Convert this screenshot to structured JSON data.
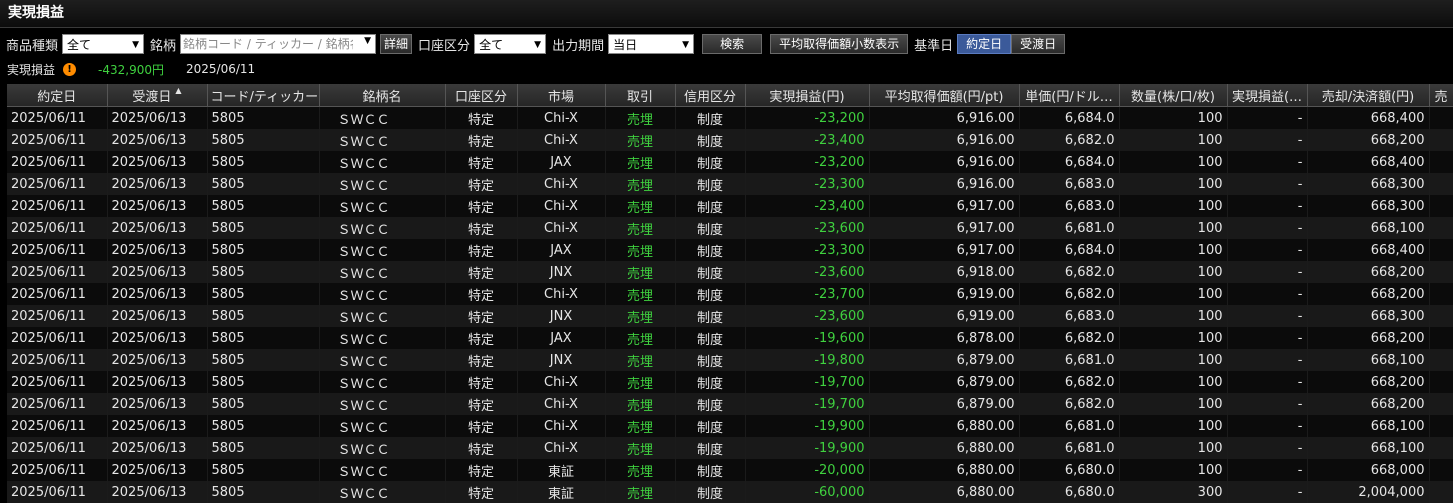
{
  "title": "実現損益",
  "filters": {
    "product_label": "商品種類",
    "product_value": "全て",
    "symbol_label": "銘柄",
    "symbol_placeholder": "銘柄コード / ティッカー / 銘柄名",
    "detail_label": "詳細",
    "account_label": "口座区分",
    "account_value": "全て",
    "period_label": "出力期間",
    "period_value": "当日",
    "search_label": "検索",
    "decimal_label": "平均取得価額小数表示",
    "basis_label": "基準日",
    "basis_contract": "約定日",
    "basis_delivery": "受渡日"
  },
  "summary": {
    "label": "実現損益",
    "value": "-432,900円",
    "date": "2025/06/11"
  },
  "columns": [
    "約定日",
    "受渡日",
    "コード/ティッカー",
    "銘柄名",
    "口座区分",
    "市場",
    "取引",
    "信用区分",
    "実現損益(円)",
    "平均取得価額(円/pt)",
    "単価(円/ドル…",
    "数量(株/口/枚)",
    "実現損益(…",
    "売却/決済額(円)",
    "売"
  ],
  "rows": [
    [
      "2025/06/11",
      "2025/06/13",
      "5805",
      "ＳＷＣＣ",
      "特定",
      "Chi-X",
      "売埋",
      "制度",
      "-23,200",
      "6,916.00",
      "6,684.0",
      "100",
      "-",
      "668,400"
    ],
    [
      "2025/06/11",
      "2025/06/13",
      "5805",
      "ＳＷＣＣ",
      "特定",
      "Chi-X",
      "売埋",
      "制度",
      "-23,400",
      "6,916.00",
      "6,682.0",
      "100",
      "-",
      "668,200"
    ],
    [
      "2025/06/11",
      "2025/06/13",
      "5805",
      "ＳＷＣＣ",
      "特定",
      "JAX",
      "売埋",
      "制度",
      "-23,200",
      "6,916.00",
      "6,684.0",
      "100",
      "-",
      "668,400"
    ],
    [
      "2025/06/11",
      "2025/06/13",
      "5805",
      "ＳＷＣＣ",
      "特定",
      "Chi-X",
      "売埋",
      "制度",
      "-23,300",
      "6,916.00",
      "6,683.0",
      "100",
      "-",
      "668,300"
    ],
    [
      "2025/06/11",
      "2025/06/13",
      "5805",
      "ＳＷＣＣ",
      "特定",
      "Chi-X",
      "売埋",
      "制度",
      "-23,400",
      "6,917.00",
      "6,683.0",
      "100",
      "-",
      "668,300"
    ],
    [
      "2025/06/11",
      "2025/06/13",
      "5805",
      "ＳＷＣＣ",
      "特定",
      "Chi-X",
      "売埋",
      "制度",
      "-23,600",
      "6,917.00",
      "6,681.0",
      "100",
      "-",
      "668,100"
    ],
    [
      "2025/06/11",
      "2025/06/13",
      "5805",
      "ＳＷＣＣ",
      "特定",
      "JAX",
      "売埋",
      "制度",
      "-23,300",
      "6,917.00",
      "6,684.0",
      "100",
      "-",
      "668,400"
    ],
    [
      "2025/06/11",
      "2025/06/13",
      "5805",
      "ＳＷＣＣ",
      "特定",
      "JNX",
      "売埋",
      "制度",
      "-23,600",
      "6,918.00",
      "6,682.0",
      "100",
      "-",
      "668,200"
    ],
    [
      "2025/06/11",
      "2025/06/13",
      "5805",
      "ＳＷＣＣ",
      "特定",
      "Chi-X",
      "売埋",
      "制度",
      "-23,700",
      "6,919.00",
      "6,682.0",
      "100",
      "-",
      "668,200"
    ],
    [
      "2025/06/11",
      "2025/06/13",
      "5805",
      "ＳＷＣＣ",
      "特定",
      "JNX",
      "売埋",
      "制度",
      "-23,600",
      "6,919.00",
      "6,683.0",
      "100",
      "-",
      "668,300"
    ],
    [
      "2025/06/11",
      "2025/06/13",
      "5805",
      "ＳＷＣＣ",
      "特定",
      "JAX",
      "売埋",
      "制度",
      "-19,600",
      "6,878.00",
      "6,682.0",
      "100",
      "-",
      "668,200"
    ],
    [
      "2025/06/11",
      "2025/06/13",
      "5805",
      "ＳＷＣＣ",
      "特定",
      "JNX",
      "売埋",
      "制度",
      "-19,800",
      "6,879.00",
      "6,681.0",
      "100",
      "-",
      "668,100"
    ],
    [
      "2025/06/11",
      "2025/06/13",
      "5805",
      "ＳＷＣＣ",
      "特定",
      "Chi-X",
      "売埋",
      "制度",
      "-19,700",
      "6,879.00",
      "6,682.0",
      "100",
      "-",
      "668,200"
    ],
    [
      "2025/06/11",
      "2025/06/13",
      "5805",
      "ＳＷＣＣ",
      "特定",
      "Chi-X",
      "売埋",
      "制度",
      "-19,700",
      "6,879.00",
      "6,682.0",
      "100",
      "-",
      "668,200"
    ],
    [
      "2025/06/11",
      "2025/06/13",
      "5805",
      "ＳＷＣＣ",
      "特定",
      "Chi-X",
      "売埋",
      "制度",
      "-19,900",
      "6,880.00",
      "6,681.0",
      "100",
      "-",
      "668,100"
    ],
    [
      "2025/06/11",
      "2025/06/13",
      "5805",
      "ＳＷＣＣ",
      "特定",
      "Chi-X",
      "売埋",
      "制度",
      "-19,900",
      "6,880.00",
      "6,681.0",
      "100",
      "-",
      "668,100"
    ],
    [
      "2025/06/11",
      "2025/06/13",
      "5805",
      "ＳＷＣＣ",
      "特定",
      "東証",
      "売埋",
      "制度",
      "-20,000",
      "6,880.00",
      "6,680.0",
      "100",
      "-",
      "668,000"
    ],
    [
      "2025/06/11",
      "2025/06/13",
      "5805",
      "ＳＷＣＣ",
      "特定",
      "東証",
      "売埋",
      "制度",
      "-60,000",
      "6,880.00",
      "6,680.0",
      "300",
      "-",
      "2,004,000"
    ]
  ],
  "colors": {
    "loss_text": "#3fd13f",
    "trade_text": "#3fd13f",
    "warning": "#ff8c00",
    "active_button": "#3b5a9a"
  },
  "icons": {
    "warning": "warning-icon",
    "dropdown": "chevron-down-icon",
    "sort": "sort-asc-icon"
  }
}
